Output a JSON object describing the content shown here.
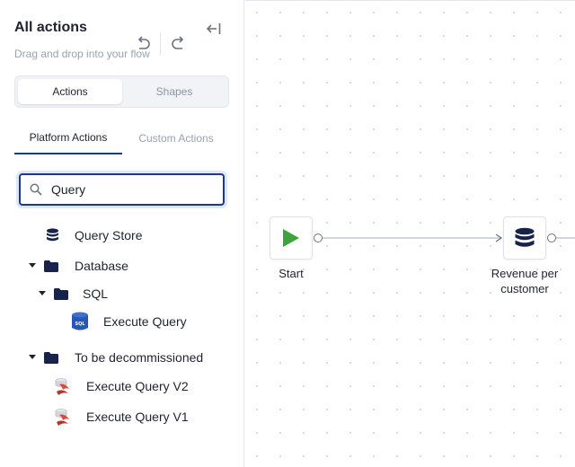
{
  "sidebar": {
    "title": "All actions",
    "subtitle": "Drag and drop into your flow",
    "segments": {
      "active": "Actions",
      "inactive": "Shapes"
    },
    "tabs": {
      "active": "Platform Actions",
      "inactive": "Custom Actions"
    },
    "search": {
      "value": "Query"
    },
    "tree": {
      "query_store": "Query Store",
      "database": "Database",
      "sql": "SQL",
      "execute_query": "Execute Query",
      "to_be_decommissioned": "To be decommissioned",
      "execute_query_v2": "Execute Query V2",
      "execute_query_v1": "Execute Query V1"
    },
    "icons": {
      "collapse": "collapse-left-icon",
      "undo": "undo-icon",
      "redo": "redo-icon",
      "search": "search-icon",
      "database": "database-icon",
      "folder": "folder-icon",
      "sql_db": "sql-database-icon",
      "legacy_db": "legacy-db-icon"
    }
  },
  "canvas": {
    "nodes": {
      "start": "Start",
      "revenue_line1": "Revenue per",
      "revenue_line2": "customer"
    }
  },
  "colors": {
    "accent": "#1a3a8f",
    "start_green": "#3ea33a",
    "db_navy": "#17234a",
    "legacy_red": "#d94a3c"
  }
}
